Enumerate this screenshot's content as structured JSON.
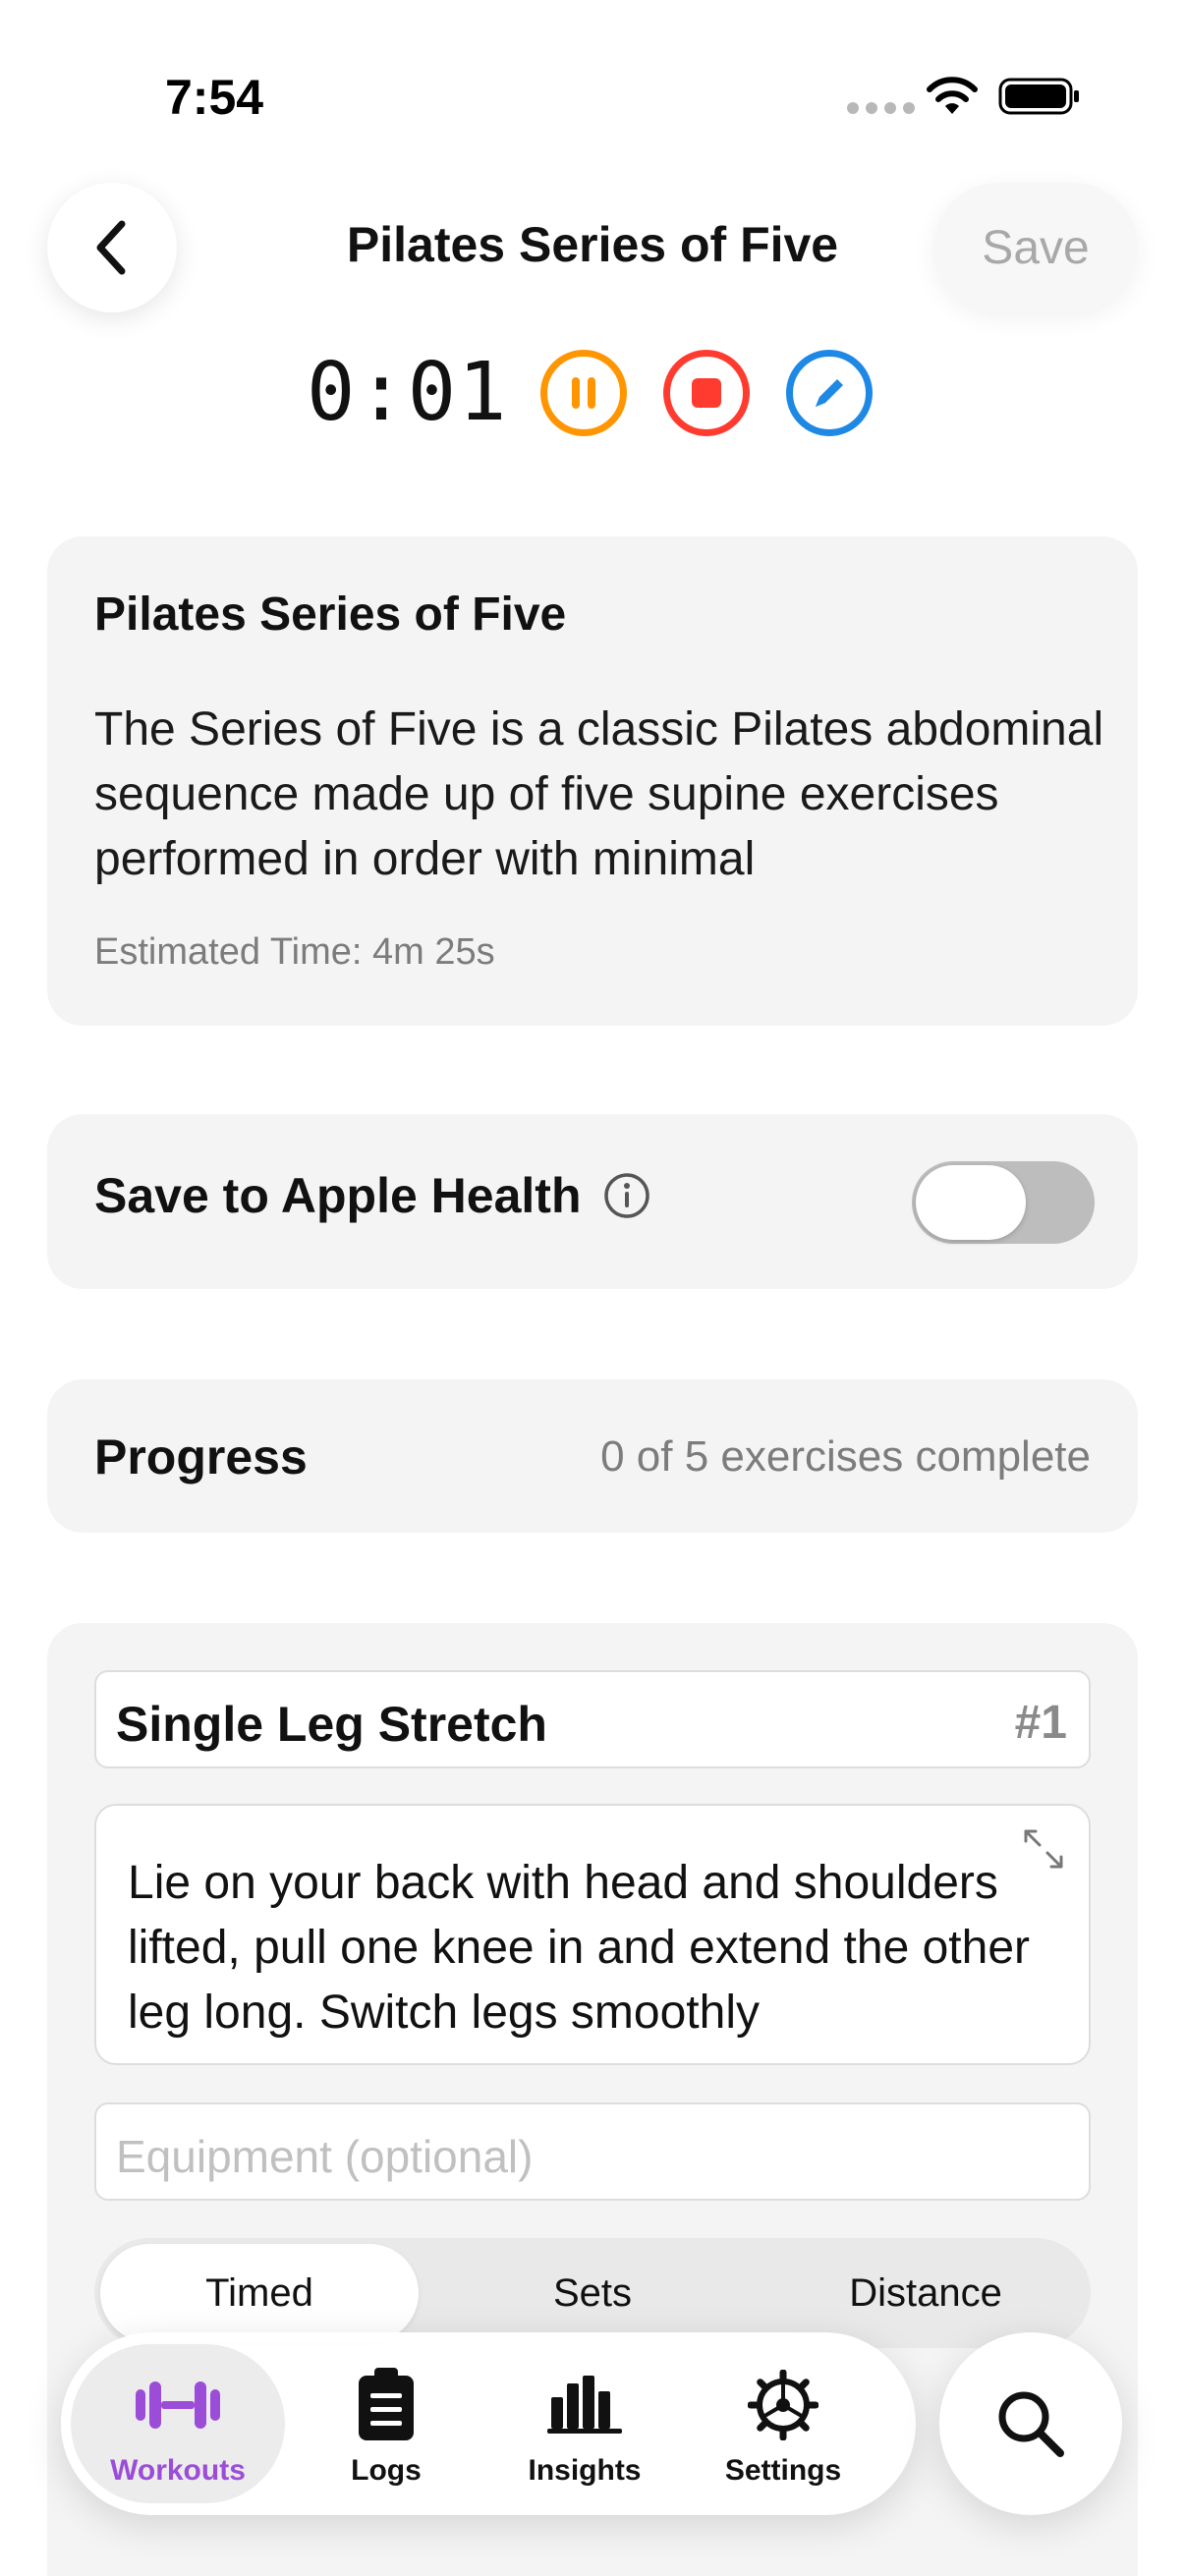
{
  "status": {
    "time": "7:54"
  },
  "nav": {
    "title": "Pilates Series of Five",
    "save_label": "Save"
  },
  "timer": {
    "elapsed": "0:01"
  },
  "workout": {
    "title": "Pilates Series of Five",
    "description": "The Series of Five is a classic Pilates abdominal sequence made up of five supine exercises performed in order with minimal",
    "estimated": "Estimated Time: 4m 25s"
  },
  "health": {
    "label": "Save to Apple Health",
    "enabled": false
  },
  "progress": {
    "label": "Progress",
    "value": "0 of 5 exercises complete"
  },
  "exercise": {
    "name": "Single Leg Stretch",
    "number": "#1",
    "description": "Lie on your back with head and shoulders lifted, pull one knee in and extend the other leg long. Switch legs smoothly",
    "equipment_placeholder": "Equipment (optional)",
    "modes": [
      "Timed",
      "Sets",
      "Distance"
    ],
    "selected_mode": "Timed"
  },
  "tabs": [
    {
      "label": "Workouts",
      "icon": "dumbbell-icon",
      "active": true
    },
    {
      "label": "Logs",
      "icon": "clipboard-icon",
      "active": false
    },
    {
      "label": "Insights",
      "icon": "bar-chart-icon",
      "active": false
    },
    {
      "label": "Settings",
      "icon": "gear-icon",
      "active": false
    }
  ],
  "colors": {
    "accent": "#9b4dd8",
    "pause": "#ff9500",
    "stop": "#ff3b30",
    "edit": "#1e88e5"
  }
}
